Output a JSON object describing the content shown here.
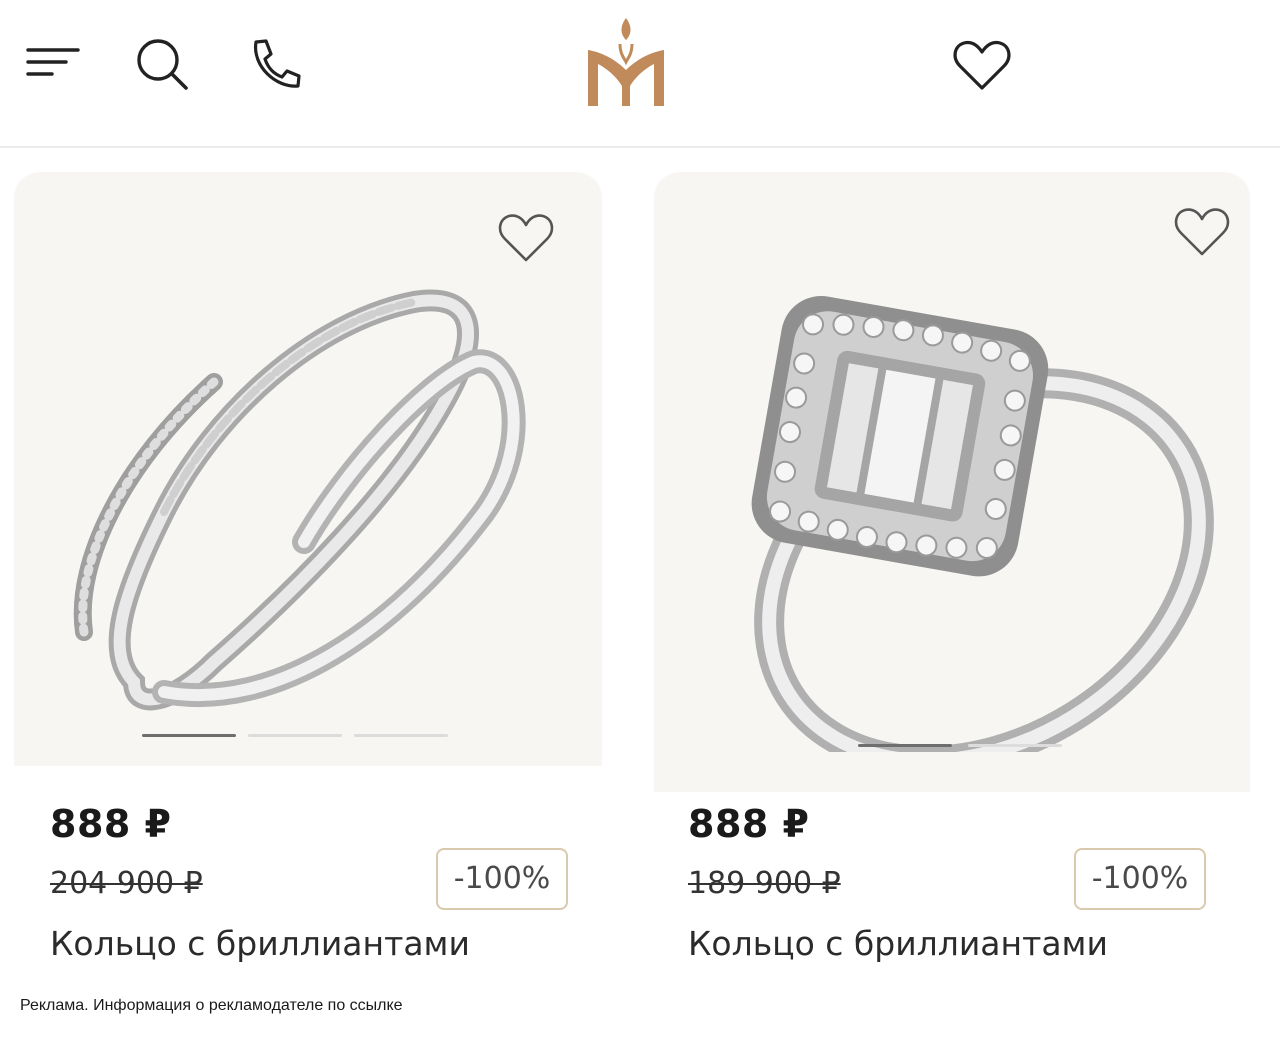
{
  "colors": {
    "brand": "#c08a5b",
    "badge_border": "#d9c9ad",
    "card_bg": "#f7f6f3"
  },
  "header": {
    "icons": [
      "menu-icon",
      "search-icon",
      "phone-icon",
      "brand-logo",
      "heart-icon"
    ]
  },
  "products": [
    {
      "price": "888 ₽",
      "old_price": "204 900 ₽",
      "discount": "-100%",
      "name": "Кольцо с бриллиантами",
      "image_dots": 3,
      "active_dot": 1
    },
    {
      "price": "888 ₽",
      "old_price": "189 900 ₽",
      "discount": "-100%",
      "name": "Кольцо с бриллиантами",
      "image_dots": 2,
      "active_dot": 1
    }
  ],
  "footer": {
    "disclaimer": "Реклама. Информация о рекламодателе по ссылке"
  }
}
